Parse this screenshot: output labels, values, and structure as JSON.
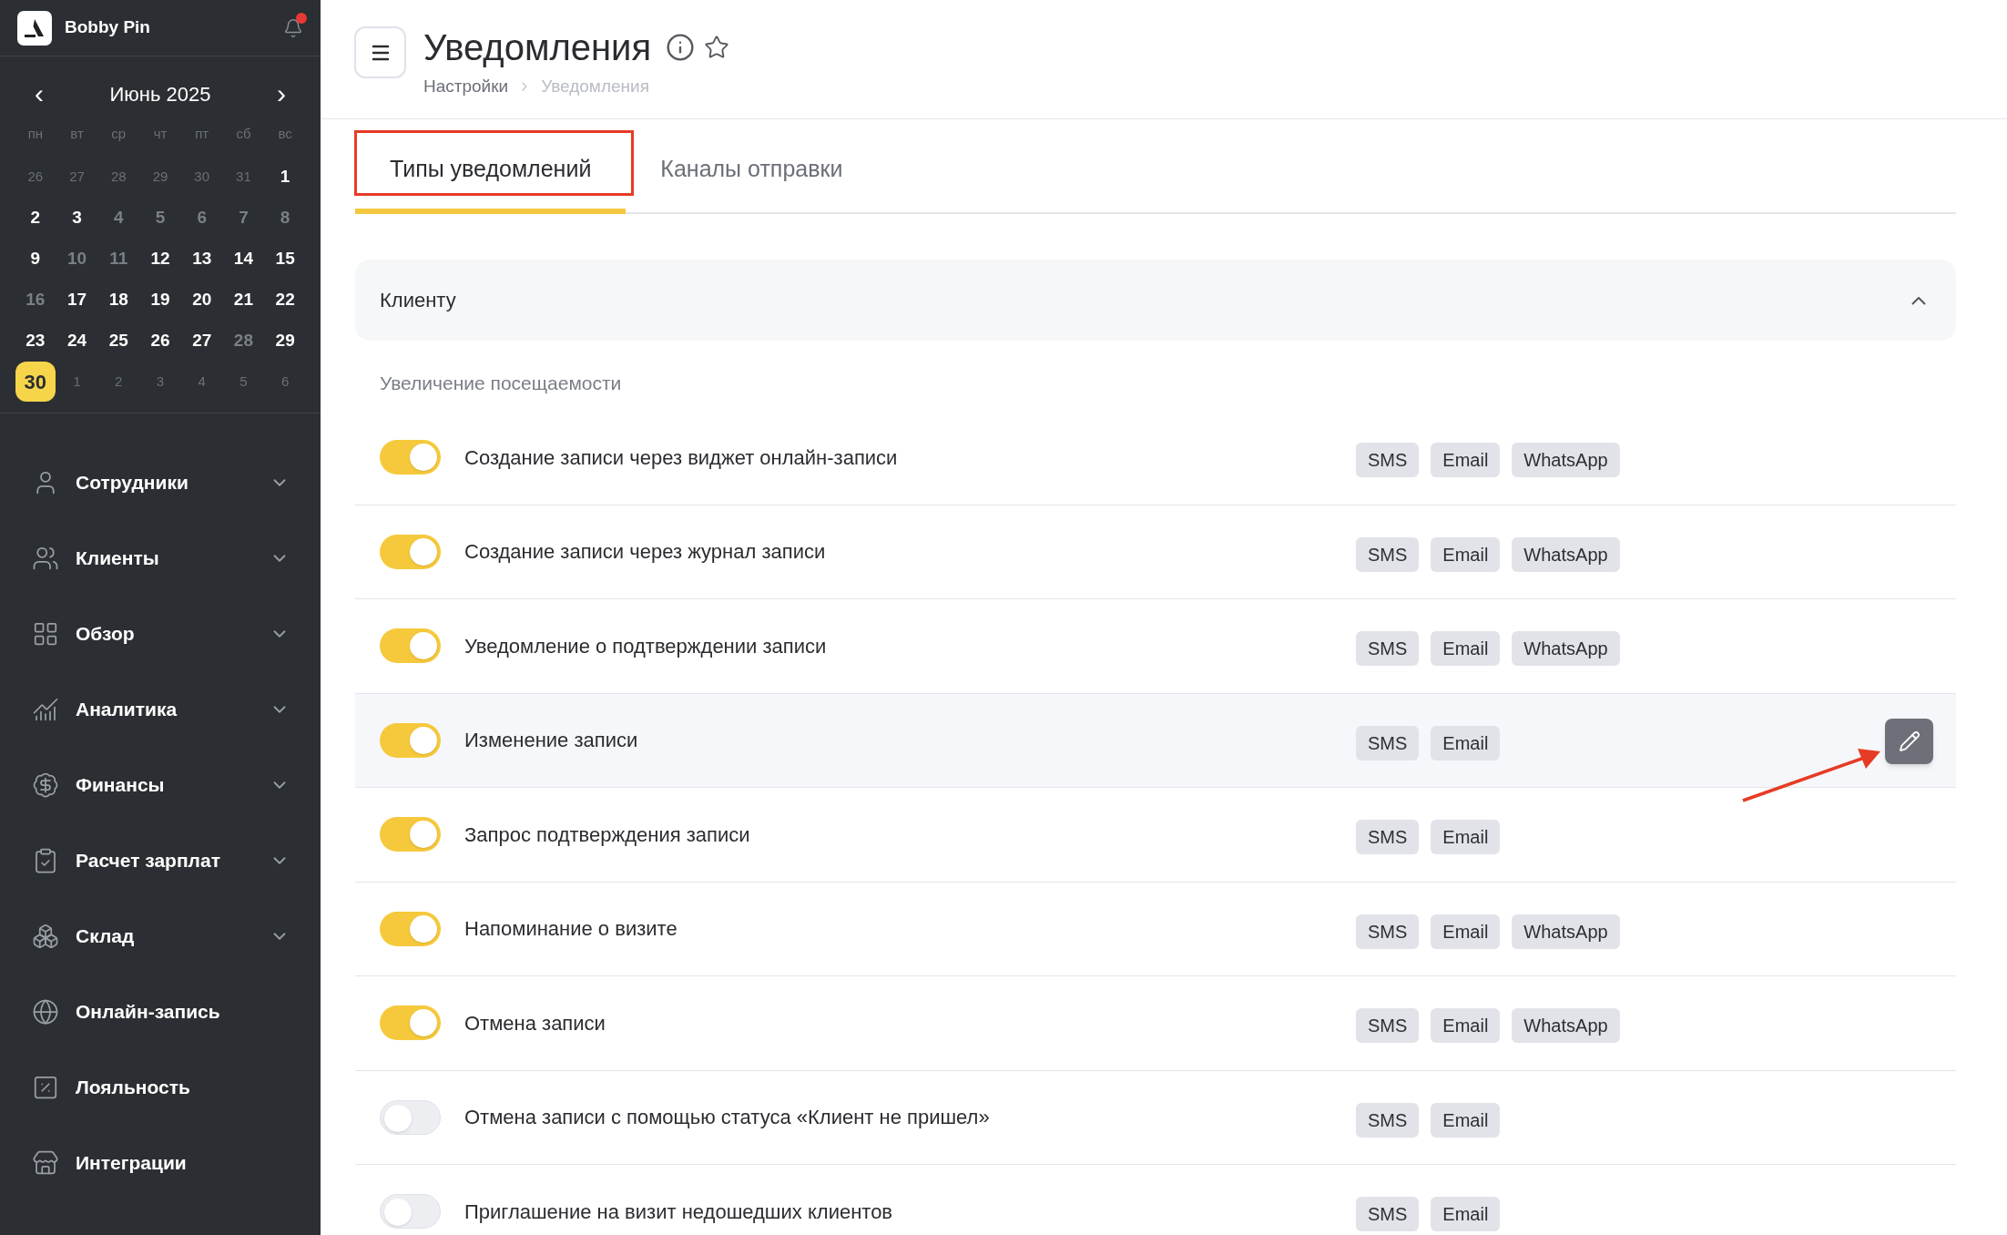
{
  "sidebar": {
    "brand": "Bobby Pin",
    "has_notification": true,
    "calendar": {
      "month": "Июнь 2025",
      "prev": "‹",
      "next": "›",
      "weekdays": [
        "пн",
        "вт",
        "ср",
        "чт",
        "пт",
        "сб",
        "вс"
      ],
      "weeks": [
        [
          {
            "day": "26",
            "kind": "outside",
            "selected": false
          },
          {
            "day": "27",
            "kind": "outside",
            "selected": false
          },
          {
            "day": "28",
            "kind": "outside",
            "selected": false
          },
          {
            "day": "29",
            "kind": "outside",
            "selected": false
          },
          {
            "day": "30",
            "kind": "outside",
            "selected": false
          },
          {
            "day": "31",
            "kind": "outside",
            "selected": false
          },
          {
            "day": "1",
            "kind": "open",
            "selected": false
          }
        ],
        [
          {
            "day": "2",
            "kind": "open",
            "selected": false
          },
          {
            "day": "3",
            "kind": "open",
            "selected": false
          },
          {
            "day": "4",
            "kind": "closed",
            "selected": false
          },
          {
            "day": "5",
            "kind": "closed",
            "selected": false
          },
          {
            "day": "6",
            "kind": "closed",
            "selected": false
          },
          {
            "day": "7",
            "kind": "closed",
            "selected": false
          },
          {
            "day": "8",
            "kind": "closed",
            "selected": false
          }
        ],
        [
          {
            "day": "9",
            "kind": "open",
            "selected": false
          },
          {
            "day": "10",
            "kind": "closed",
            "selected": false
          },
          {
            "day": "11",
            "kind": "closed",
            "selected": false
          },
          {
            "day": "12",
            "kind": "open",
            "selected": false
          },
          {
            "day": "13",
            "kind": "open",
            "selected": false
          },
          {
            "day": "14",
            "kind": "open",
            "selected": false
          },
          {
            "day": "15",
            "kind": "open",
            "selected": false
          }
        ],
        [
          {
            "day": "16",
            "kind": "closed",
            "selected": false
          },
          {
            "day": "17",
            "kind": "open",
            "selected": false
          },
          {
            "day": "18",
            "kind": "open",
            "selected": false
          },
          {
            "day": "19",
            "kind": "open",
            "selected": false
          },
          {
            "day": "20",
            "kind": "open",
            "selected": false
          },
          {
            "day": "21",
            "kind": "open",
            "selected": false
          },
          {
            "day": "22",
            "kind": "open",
            "selected": false
          }
        ],
        [
          {
            "day": "23",
            "kind": "open",
            "selected": false
          },
          {
            "day": "24",
            "kind": "open",
            "selected": false
          },
          {
            "day": "25",
            "kind": "open",
            "selected": false
          },
          {
            "day": "26",
            "kind": "open",
            "selected": false
          },
          {
            "day": "27",
            "kind": "open",
            "selected": false
          },
          {
            "day": "28",
            "kind": "closed",
            "selected": false
          },
          {
            "day": "29",
            "kind": "open",
            "selected": false
          }
        ],
        [
          {
            "day": "30",
            "kind": "open",
            "selected": true
          },
          {
            "day": "1",
            "kind": "outside",
            "selected": false
          },
          {
            "day": "2",
            "kind": "outside",
            "selected": false
          },
          {
            "day": "3",
            "kind": "outside",
            "selected": false
          },
          {
            "day": "4",
            "kind": "outside",
            "selected": false
          },
          {
            "day": "5",
            "kind": "outside",
            "selected": false
          },
          {
            "day": "6",
            "kind": "outside",
            "selected": false
          }
        ]
      ]
    },
    "items": [
      {
        "label": "Сотрудники",
        "expandable": true
      },
      {
        "label": "Клиенты",
        "expandable": true
      },
      {
        "label": "Обзор",
        "expandable": true
      },
      {
        "label": "Аналитика",
        "expandable": true
      },
      {
        "label": "Финансы",
        "expandable": true
      },
      {
        "label": "Расчет зарплат",
        "expandable": true
      },
      {
        "label": "Склад",
        "expandable": true
      },
      {
        "label": "Онлайн-запись",
        "expandable": false
      },
      {
        "label": "Лояльность",
        "expandable": false
      },
      {
        "label": "Интеграции",
        "expandable": false
      }
    ]
  },
  "header": {
    "title": "Уведомления",
    "breadcrumbs": [
      {
        "label": "Настройки",
        "current": false
      },
      {
        "label": "Уведомления",
        "current": true
      }
    ]
  },
  "tabs": [
    {
      "label": "Типы уведомлений",
      "selected": true
    },
    {
      "label": "Каналы отправки",
      "selected": false
    }
  ],
  "section": {
    "title": "Клиенту",
    "expanded": true,
    "group": "Увеличение посещаемости",
    "rows": [
      {
        "label": "Создание записи через виджет онлайн-записи",
        "on": true,
        "hovered": false,
        "channels": [
          "SMS",
          "Email",
          "WhatsApp"
        ]
      },
      {
        "label": "Создание записи через журнал записи",
        "on": true,
        "hovered": false,
        "channels": [
          "SMS",
          "Email",
          "WhatsApp"
        ]
      },
      {
        "label": "Уведомление о подтверждении записи",
        "on": true,
        "hovered": false,
        "channels": [
          "SMS",
          "Email",
          "WhatsApp"
        ]
      },
      {
        "label": "Изменение записи",
        "on": true,
        "hovered": true,
        "channels": [
          "SMS",
          "Email"
        ]
      },
      {
        "label": "Запрос подтверждения записи",
        "on": true,
        "hovered": false,
        "channels": [
          "SMS",
          "Email"
        ]
      },
      {
        "label": "Напоминание о визите",
        "on": true,
        "hovered": false,
        "channels": [
          "SMS",
          "Email",
          "WhatsApp"
        ]
      },
      {
        "label": "Отмена записи",
        "on": true,
        "hovered": false,
        "channels": [
          "SMS",
          "Email",
          "WhatsApp"
        ]
      },
      {
        "label": "Отмена записи с помощью статуса «Клиент не пришел»",
        "on": false,
        "hovered": false,
        "channels": [
          "SMS",
          "Email"
        ]
      },
      {
        "label": "Приглашение на визит недошедших клиентов",
        "on": false,
        "hovered": false,
        "channels": [
          "SMS",
          "Email"
        ]
      }
    ]
  }
}
